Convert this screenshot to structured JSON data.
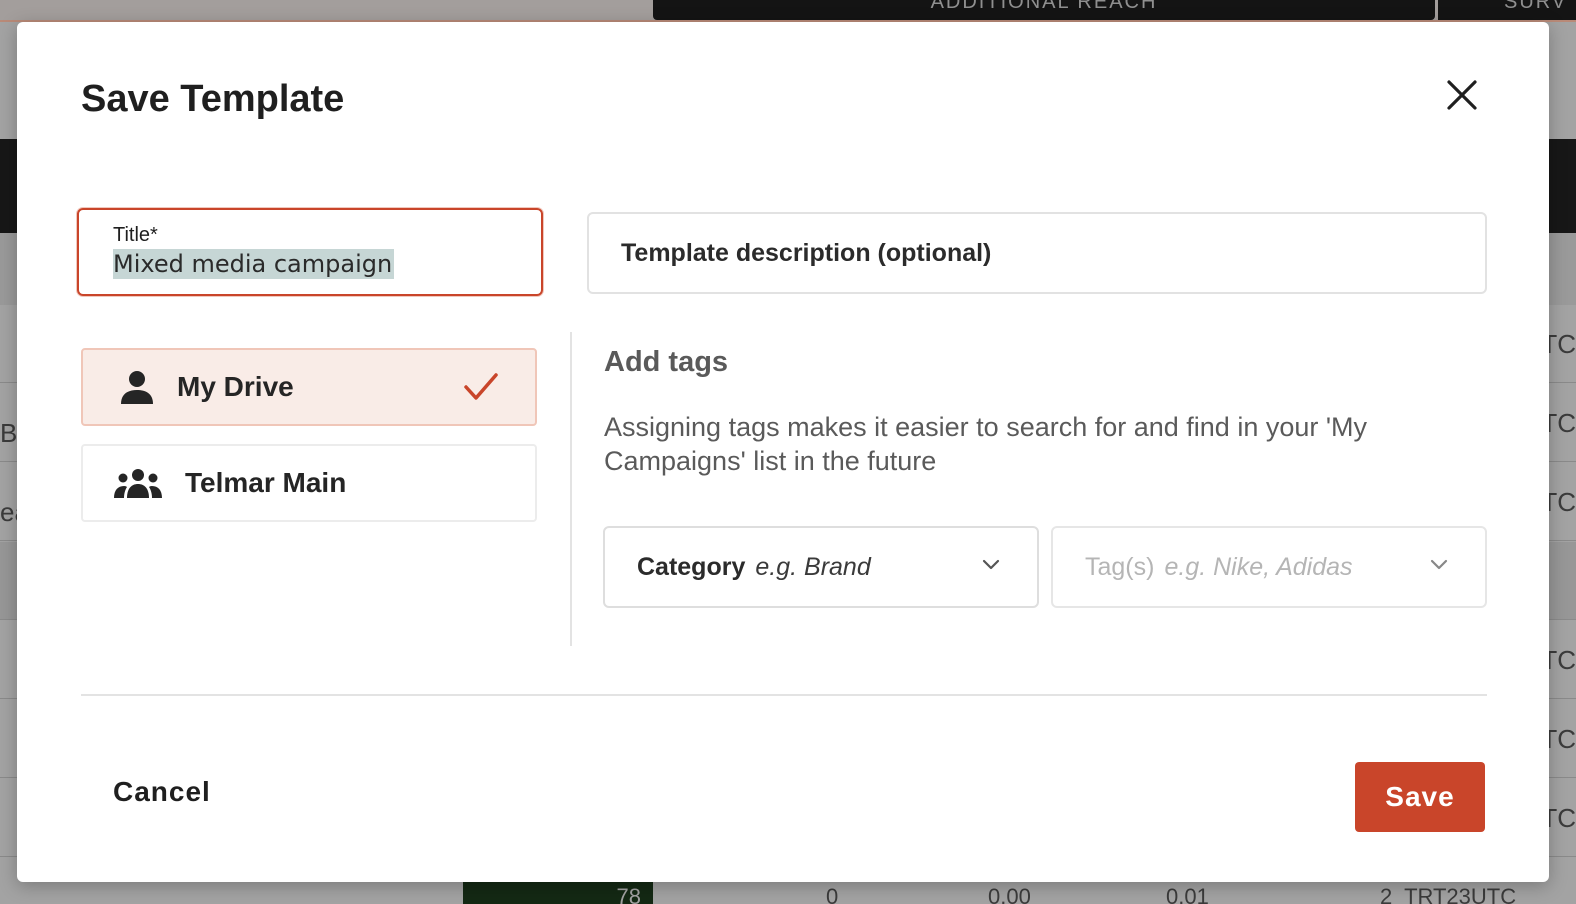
{
  "background": {
    "tab_1": "ADDITIONAL REACH",
    "tab_2": "SURV",
    "row_right_fragment": "TC",
    "row_left_fragments": [
      "Br",
      "ea"
    ],
    "bottom_cell_value": "78",
    "bottom_values": [
      "0",
      "0.00",
      "0.01",
      "2  TRT23UTC"
    ]
  },
  "modal": {
    "title": "Save Template",
    "title_field": {
      "label": "Title*",
      "value": "Mixed media campaign"
    },
    "description_field": {
      "placeholder": "Template description (optional)"
    },
    "drive_options": [
      {
        "label": "My Drive",
        "icon": "person-icon",
        "selected": true
      },
      {
        "label": "Telmar Main",
        "icon": "group-icon",
        "selected": false
      }
    ],
    "tags": {
      "heading": "Add tags",
      "description": "Assigning tags makes it easier to search for and find in your 'My Campaigns' list in the future",
      "category": {
        "label": "Category",
        "placeholder": "e.g. Brand"
      },
      "tag": {
        "label": "Tag(s)",
        "placeholder": "e.g. Nike, Adidas"
      }
    },
    "buttons": {
      "cancel": "Cancel",
      "save": "Save"
    }
  },
  "colors": {
    "accent": "#c9452a",
    "selected_bg": "#f9ece7",
    "text_dark": "#1f1f1f",
    "text_muted": "#5a5a5a"
  }
}
